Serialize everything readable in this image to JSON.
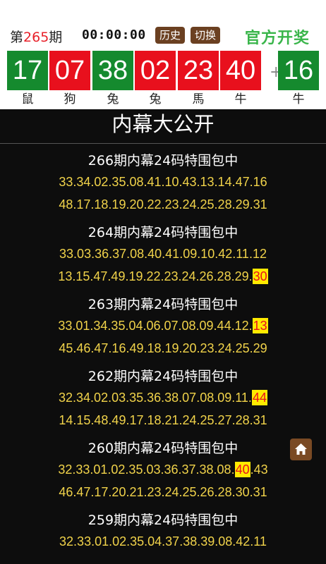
{
  "header": {
    "issue_prefix": "第",
    "issue_number": "265",
    "issue_suffix": "期",
    "timer": "00:00:00",
    "history_label": "历史",
    "switch_label": "切换",
    "brand": "官方开奖"
  },
  "balls": [
    {
      "number": "17",
      "zodiac": "鼠",
      "color": "green"
    },
    {
      "number": "07",
      "zodiac": "狗",
      "color": "red"
    },
    {
      "number": "38",
      "zodiac": "兔",
      "color": "green"
    },
    {
      "number": "02",
      "zodiac": "兔",
      "color": "red"
    },
    {
      "number": "23",
      "zodiac": "馬",
      "color": "red"
    },
    {
      "number": "40",
      "zodiac": "牛",
      "color": "red"
    }
  ],
  "plus": "+",
  "special": {
    "number": "16",
    "zodiac": "牛",
    "color": "green"
  },
  "banner": "内幕大公开",
  "records": [
    {
      "title": "266期内幕24码特围包中",
      "line1": "33.34.02.35.08.41.10.43.13.14.47.16",
      "line1_hl": "",
      "line2": "48.17.18.19.20.22.23.24.25.28.29.31",
      "line2_hl": ""
    },
    {
      "title": "264期内幕24码特围包中",
      "line1": "33.03.36.37.08.40.41.09.10.42.11.12",
      "line1_hl": "",
      "line2": "13.15.47.49.19.22.23.24.26.28.29.",
      "line2_hl": "30"
    },
    {
      "title": "263期内幕24码特围包中",
      "line1": "33.01.34.35.04.06.07.08.09.44.12.",
      "line1_hl": "13",
      "line2": "45.46.47.16.49.18.19.20.23.24.25.29",
      "line2_hl": ""
    },
    {
      "title": "262期内幕24码特围包中",
      "line1": "32.34.02.03.35.36.38.07.08.09.11.",
      "line1_hl": "44",
      "line2": "14.15.48.49.17.18.21.24.25.27.28.31",
      "line2_hl": ""
    },
    {
      "title": "260期内幕24码特围包中",
      "line1_pre": "32.33.01.02.35.03.36.37.38.08.",
      "line1_hl": "40",
      "line1_post": ".43",
      "line2": "46.47.17.20.21.23.24.25.26.28.30.31",
      "line2_hl": ""
    },
    {
      "title": "259期内幕24码特围包中",
      "line1": "32.33.01.02.35.04.37.38.39.08.42.11",
      "line1_hl": ""
    }
  ]
}
